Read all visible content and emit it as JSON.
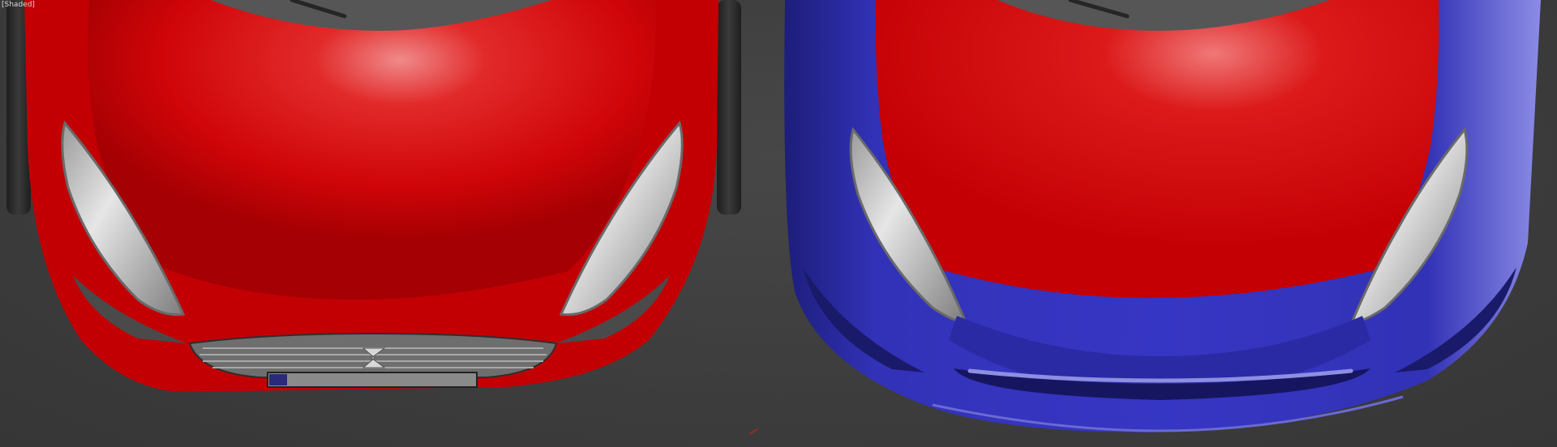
{
  "viewport": {
    "shading_label": "[Shaded]"
  },
  "scene": {
    "left_model": {
      "body_color": "#d00006",
      "highlight_color": "#f27070",
      "trim_color": "#7a0000"
    },
    "right_model": {
      "body_color": "#3434c0",
      "hood_color": "#d00006",
      "highlight_color": "#8a8ae8",
      "trim_color": "#1a1a6a"
    },
    "headlight_color": "#c8c8c8",
    "background_color": "#3c3c3c"
  }
}
